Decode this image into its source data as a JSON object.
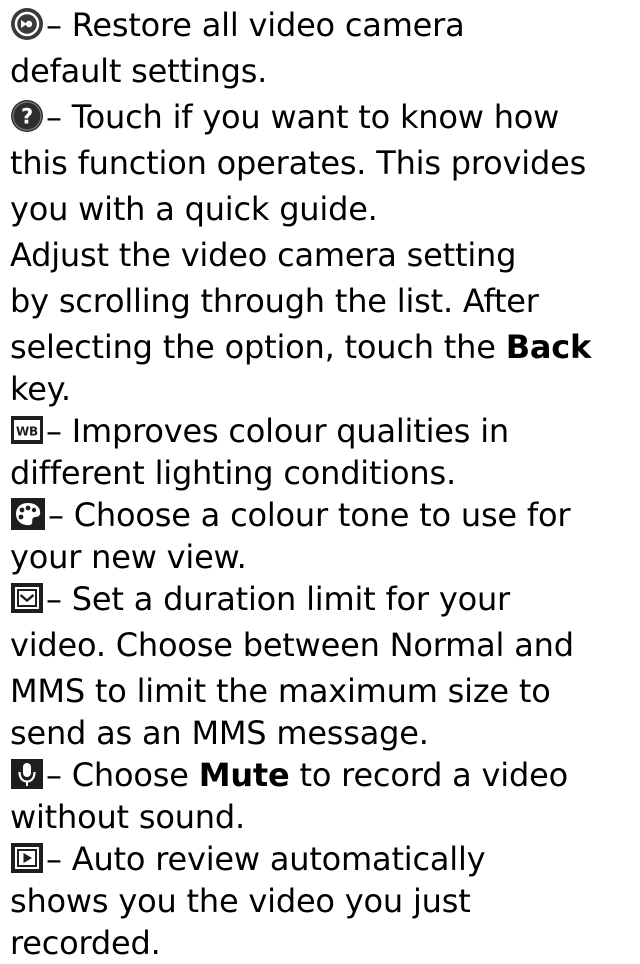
{
  "items": {
    "restore": {
      "icon": "restore-icon",
      "lines": [
        "– Restore all video camera",
        "default settings."
      ]
    },
    "help": {
      "icon": "help-icon",
      "lines": [
        "– Touch if you want to know how",
        "this function operates. This provides",
        "you with a quick guide."
      ]
    },
    "adjust": {
      "lines": [
        "Adjust the video camera setting",
        "by scrolling through the list. After"
      ],
      "line3_pre": "selecting the option, touch the ",
      "line3_bold": "Back",
      "line4": "key."
    },
    "white_balance": {
      "icon": "white-balance-icon",
      "icon_text": "WB",
      "lines": [
        "– Improves colour qualities in",
        "different lighting conditions."
      ]
    },
    "colour_effect": {
      "icon": "colour-palette-icon",
      "lines": [
        "– Choose a colour tone to use for",
        "your new view."
      ]
    },
    "duration": {
      "icon": "duration-limit-icon",
      "lines": [
        "– Set a duration limit for your",
        "video. Choose between Normal and",
        "MMS to limit the maximum size to",
        "send as an MMS message."
      ]
    },
    "audio": {
      "icon": "microphone-icon",
      "line1_pre": "– Choose ",
      "line1_bold": "Mute",
      "line1_post": " to record a video",
      "line2": "without sound."
    },
    "auto_review": {
      "icon": "auto-review-icon",
      "lines": [
        "– Auto review automatically",
        "shows you the video you just",
        "recorded."
      ]
    }
  }
}
